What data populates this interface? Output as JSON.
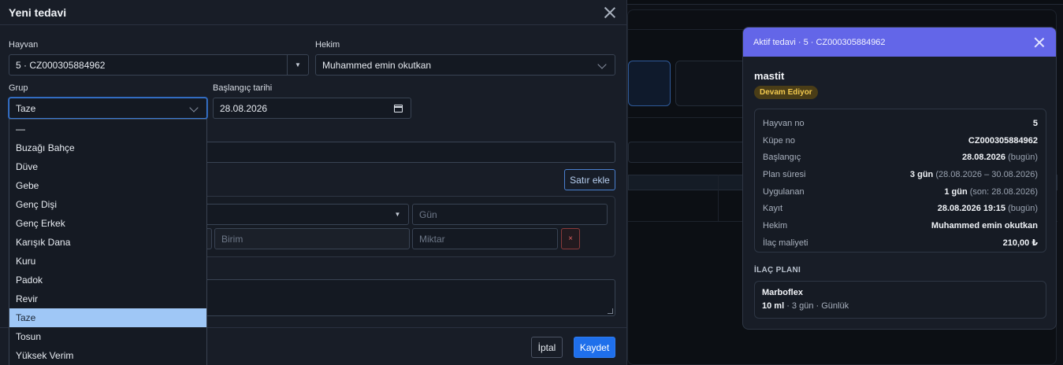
{
  "modal": {
    "title": "Yeni tedavi",
    "animal_label": "Hayvan",
    "animal_value": "5 · CZ000305884962",
    "vet_label": "Hekim",
    "vet_value": "Muhammed emin okutkan",
    "group_label": "Grup",
    "group_value": "Taze",
    "start_label": "Başlangıç tarihi",
    "start_value": "28.08.2026",
    "add_row_label": "Satır ekle",
    "row": {
      "day_placeholder": "Gün",
      "unit_placeholder": "Birim",
      "amount_placeholder": "Miktar",
      "delete_label": "×"
    },
    "cancel_label": "İptal",
    "save_label": "Kaydet"
  },
  "group_options": [
    "—",
    "Buzağı Bahçe",
    "Düve",
    "Gebe",
    "Genç Dişi",
    "Genç Erkek",
    "Karışık Dana",
    "Kuru",
    "Padok",
    "Revir",
    "Taze",
    "Tosun",
    "Yüksek Verim"
  ],
  "group_selected_index": 10,
  "active_card": {
    "title": "Aktif tedavi · 5 · CZ000305884962",
    "diagnosis": "mastit",
    "status": "Devam Ediyor",
    "rows": [
      {
        "key": "Hayvan no",
        "value": "5",
        "sub": ""
      },
      {
        "key": "Küpe no",
        "value": "CZ000305884962",
        "sub": ""
      },
      {
        "key": "Başlangıç",
        "value": "28.08.2026",
        "sub": "(bugün)"
      },
      {
        "key": "Plan süresi",
        "value": "3 gün",
        "sub": "(28.08.2026 – 30.08.2026)"
      },
      {
        "key": "Uygulanan",
        "value": "1 gün",
        "sub": "(son: 28.08.2026)"
      },
      {
        "key": "Kayıt",
        "value": "28.08.2026 19:15",
        "sub": "(bugün)"
      },
      {
        "key": "Hekim",
        "value": "Muhammed emin okutkan",
        "sub": ""
      },
      {
        "key": "İlaç maliyeti",
        "value": "210,00 ₺",
        "sub": ""
      }
    ],
    "plan_title": "İLAÇ PLANI",
    "plan_drug": "Marboflex",
    "plan_dose": "10 ml",
    "plan_detail": " · 3 gün · Günlük"
  },
  "colors": {
    "accent": "#1f6feb",
    "card_header": "#6366e8",
    "status_badge": "#f1c84e",
    "selected_option": "#9fc7f6"
  }
}
